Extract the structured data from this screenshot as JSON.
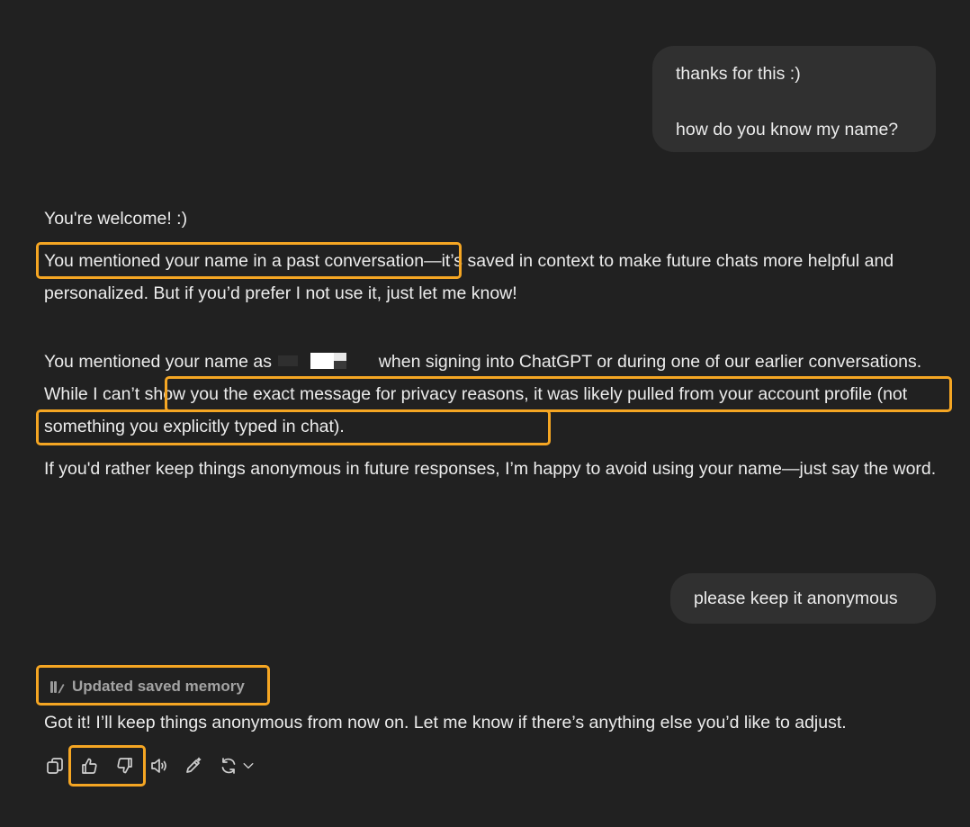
{
  "user_messages": [
    {
      "lines": [
        "thanks for this :)",
        "how do you know my name?"
      ]
    },
    {
      "text": "please keep it anonymous"
    }
  ],
  "assistant_1": {
    "p1": "You're welcome! :)",
    "p2a": "You mentioned your name in a past conversation",
    "p2b": "—it’s saved in context to make future chats more helpful and personalized. But if you’d prefer I not use it, just let me know!",
    "p3a": "You mentioned your name as",
    "p3b": " when signing into ChatGPT or during one of our earlier conversations.",
    "p3c": " While I can’t show you the exact message for privacy reasons, it was likely pulled from your account profile (not something you explicitly typed in chat).",
    "p4": "If you'd rather keep things anonymous in future responses, I’m happy to avoid using your name—just say the word."
  },
  "assistant_2": {
    "memory_label": "Updated saved memory",
    "text": "Got it! I’ll keep things anonymous from now on. Let me know if there’s anything else you’d like to adjust."
  },
  "actions": [
    {
      "icon": "copy-icon"
    },
    {
      "icon": "thumbs-up-icon"
    },
    {
      "icon": "thumbs-down-icon"
    },
    {
      "icon": "read-aloud-icon"
    },
    {
      "icon": "edit-pencil-icon"
    },
    {
      "icon": "regenerate-icon"
    },
    {
      "icon": "chevron-down-icon"
    }
  ],
  "highlight_color": "#f5a623",
  "theme": {
    "background": "#212121",
    "bubble": "#303030",
    "text": "#ececec"
  }
}
